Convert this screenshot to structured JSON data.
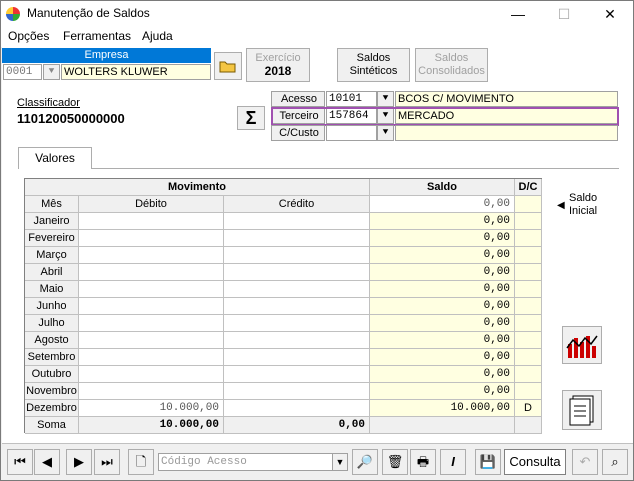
{
  "window": {
    "title": "Manutenção de Saldos",
    "minimize": "—",
    "maximize": "☐",
    "close": "✕"
  },
  "menu": [
    "Opções",
    "Ferramentas",
    "Ajuda"
  ],
  "empresa": {
    "label": "Empresa",
    "code": "0001",
    "name": "WOLTERS KLUWER"
  },
  "exercicio": {
    "label": "Exercício",
    "value": "2018"
  },
  "buttons": {
    "saldos_sinteticos": [
      "Saldos",
      "Sintéticos"
    ],
    "saldos_consolidados": [
      "Saldos",
      "Consolidados"
    ]
  },
  "classificador": {
    "label": "Classificador",
    "value": "110120050000000"
  },
  "sigma": "Σ",
  "filters": [
    {
      "label": "Acesso",
      "code": "10101",
      "desc": "BCOS C/ MOVIMENTO"
    },
    {
      "label": "Terceiro",
      "code": "157864",
      "desc": "MERCADO"
    },
    {
      "label": "C/Custo",
      "code": "",
      "desc": ""
    }
  ],
  "tab": "Valores",
  "table": {
    "group_movimento": "Movimento",
    "col_saldo": "Saldo",
    "col_dc": "D/C",
    "col_mes": "Mês",
    "col_debito": "Débito",
    "col_credito": "Crédito",
    "rows": [
      {
        "mes": "",
        "debito": "",
        "credito": "",
        "saldo": "0,00",
        "dc": ""
      },
      {
        "mes": "Janeiro",
        "debito": "",
        "credito": "",
        "saldo": "0,00",
        "dc": ""
      },
      {
        "mes": "Fevereiro",
        "debito": "",
        "credito": "",
        "saldo": "0,00",
        "dc": ""
      },
      {
        "mes": "Março",
        "debito": "",
        "credito": "",
        "saldo": "0,00",
        "dc": ""
      },
      {
        "mes": "Abril",
        "debito": "",
        "credito": "",
        "saldo": "0,00",
        "dc": ""
      },
      {
        "mes": "Maio",
        "debito": "",
        "credito": "",
        "saldo": "0,00",
        "dc": ""
      },
      {
        "mes": "Junho",
        "debito": "",
        "credito": "",
        "saldo": "0,00",
        "dc": ""
      },
      {
        "mes": "Julho",
        "debito": "",
        "credito": "",
        "saldo": "0,00",
        "dc": ""
      },
      {
        "mes": "Agosto",
        "debito": "",
        "credito": "",
        "saldo": "0,00",
        "dc": ""
      },
      {
        "mes": "Setembro",
        "debito": "",
        "credito": "",
        "saldo": "0,00",
        "dc": ""
      },
      {
        "mes": "Outubro",
        "debito": "",
        "credito": "",
        "saldo": "0,00",
        "dc": ""
      },
      {
        "mes": "Novembro",
        "debito": "",
        "credito": "",
        "saldo": "0,00",
        "dc": ""
      },
      {
        "mes": "Dezembro",
        "debito": "10.000,00",
        "credito": "",
        "saldo": "10.000,00",
        "dc": "D"
      }
    ],
    "soma": {
      "label": "Soma",
      "debito": "10.000,00",
      "credito": "0,00"
    }
  },
  "saldo_inicial": {
    "line1": "Saldo",
    "line2": "Inicial"
  },
  "status": {
    "codigo_placeholder": "Código Acesso",
    "mode": "Consulta"
  }
}
